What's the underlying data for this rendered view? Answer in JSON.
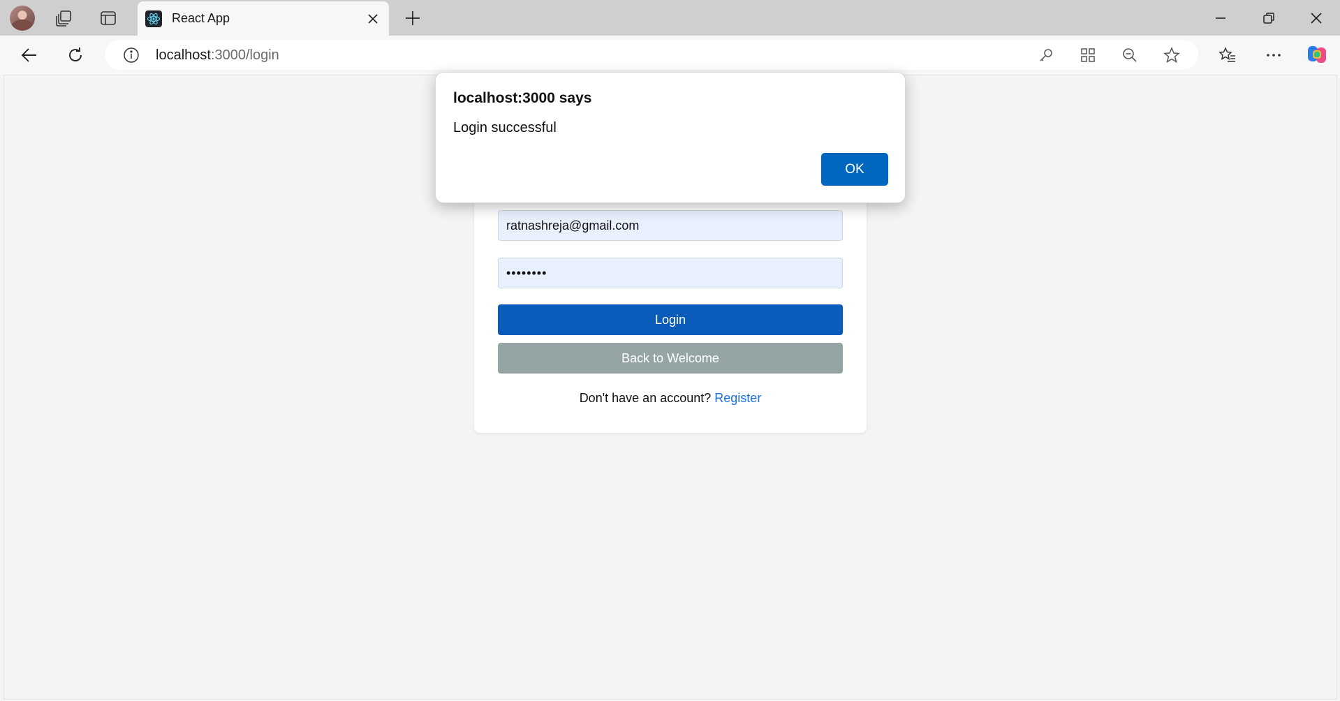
{
  "browser": {
    "tab": {
      "title": "React App"
    },
    "address": {
      "host": "localhost",
      "path": ":3000/login"
    }
  },
  "form": {
    "email_value": "ratnashreja@gmail.com",
    "password_mask": "••••••••",
    "login_label": "Login",
    "back_label": "Back to Welcome",
    "register_prompt": "Don't have an account?",
    "register_link": "Register"
  },
  "dialog": {
    "title": "localhost:3000 says",
    "message": "Login successful",
    "ok_label": "OK"
  },
  "colors": {
    "primary": "#0b5cba",
    "secondary": "#95a5a6",
    "link": "#1a73e8",
    "dialog_ok": "#0067c0"
  }
}
